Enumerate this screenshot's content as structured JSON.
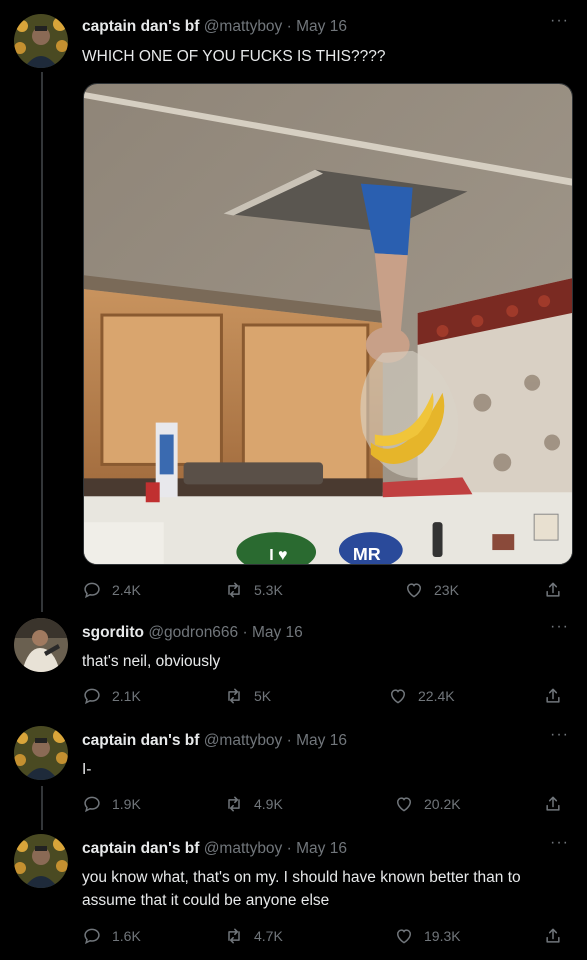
{
  "tweets": [
    {
      "name": "captain dan's bf",
      "handle": "@mattyboy",
      "date": "May 16",
      "text": "WHICH ONE OF YOU FUCKS IS THIS????",
      "replies": "2.4K",
      "retweets": "5.3K",
      "likes": "23K",
      "media": {
        "sticker_left": "I ♥",
        "sticker_right": "MR"
      }
    },
    {
      "name": "sgordito",
      "handle": "@godron666",
      "date": "May 16",
      "text": "that's neil, obviously",
      "replies": "2.1K",
      "retweets": "5K",
      "likes": "22.4K"
    },
    {
      "name": "captain dan's bf",
      "handle": "@mattyboy",
      "date": "May 16",
      "text": "I-",
      "replies": "1.9K",
      "retweets": "4.9K",
      "likes": "20.2K"
    },
    {
      "name": "captain dan's bf",
      "handle": "@mattyboy",
      "date": "May 16",
      "text": "you know what, that's on my. I should have known better than to assume that it could be anyone else",
      "replies": "1.6K",
      "retweets": "4.7K",
      "likes": "19.3K"
    }
  ],
  "ui": {
    "separator": "·",
    "more": "···"
  },
  "colors": {
    "background": "#000000",
    "text": "#e7e9ea",
    "muted": "#71767b",
    "thread_line": "#333639"
  }
}
